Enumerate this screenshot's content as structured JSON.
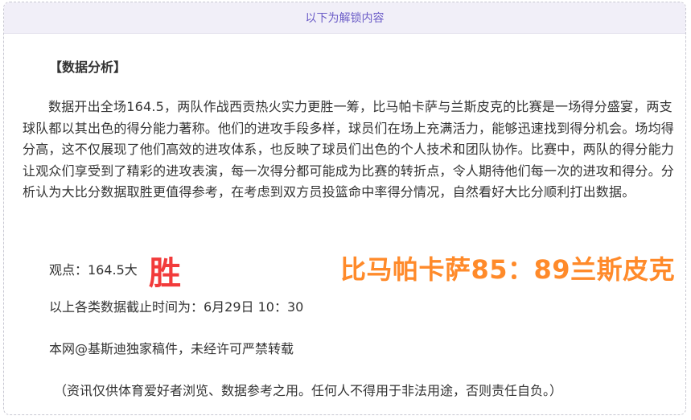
{
  "header": {
    "unlock_text": "以下为解锁内容"
  },
  "article": {
    "section_title": "【数据分析】",
    "analysis_paragraph": "数据开出全场164.5，两队作战西贡热火实力更胜一筹，比马帕卡萨与兰斯皮克的比赛是一场得分盛宴，两支球队都以其出色的得分能力著称。他们的进攻手段多样，球员们在场上充满活力，能够迅速找到得分机会。场均得分高，这不仅展现了他们高效的进攻体系，也反映了球员们出色的个人技术和团队协作。比赛中，两队的得分能力让观众们享受到了精彩的进攻表演，每一次得分都可能成为比赛的转折点，令人期待他们每一次的进攻和得分。分析认为大比分数据取胜更值得参考，在考虑到双方员投篮命中率得分情况，自然看好大比分顺利打出数据。",
    "verdict_label": "观点：164.5大",
    "verdict_big": "胜",
    "score": "比马帕卡萨85：89兰斯皮克",
    "cutoff_text": "以上各类数据截止时间为：6月29日 10：30",
    "copyright_text": "本网@基斯迪独家稿件，未经许可严禁转载",
    "disclaimer_text": "（资讯仅供体育爱好者浏览、数据参考之用。任何人不得用于非法用途，否则责任自负。）"
  },
  "colors": {
    "header_bg": "#f1eff8",
    "header_text": "#6b5cc7",
    "verdict_red": "#f23b3b",
    "score_orange": "#ff8a2a"
  }
}
